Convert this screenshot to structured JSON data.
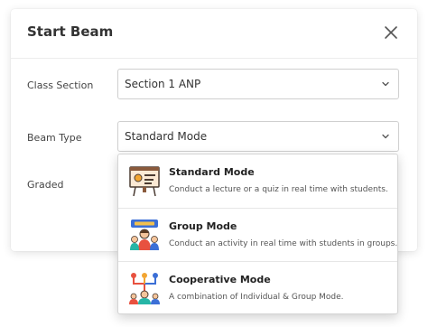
{
  "dialog": {
    "title": "Start Beam",
    "close_icon": "close-icon"
  },
  "fields": {
    "class_section": {
      "label": "Class Section",
      "value": "Section 1 ANP"
    },
    "beam_type": {
      "label": "Beam Type",
      "value": "Standard Mode"
    },
    "graded": {
      "label": "Graded"
    }
  },
  "dropdown": {
    "options": [
      {
        "name": "Standard Mode",
        "description": "Conduct a lecture or a quiz in real time with students.",
        "icon": "presentation-board-icon"
      },
      {
        "name": "Group Mode",
        "description": "Conduct an activity in real time with students in groups.",
        "icon": "group-icon"
      },
      {
        "name": "Cooperative Mode",
        "description": "A combination of Individual & Group Mode.",
        "icon": "cooperative-network-icon"
      }
    ]
  },
  "colors": {
    "text": "#333333",
    "border": "#cfcfcf",
    "icon_red": "#e8513f",
    "icon_blue": "#3b6fd6",
    "icon_orange": "#f2a531",
    "icon_teal": "#26b5a6"
  }
}
